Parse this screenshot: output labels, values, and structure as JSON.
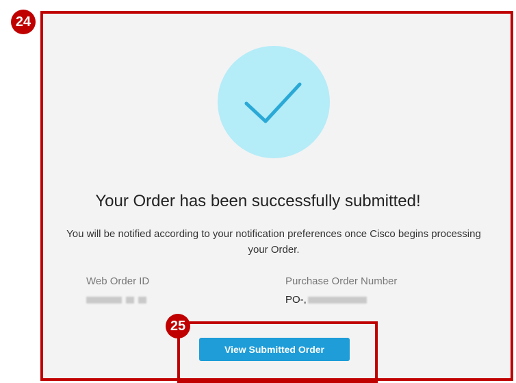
{
  "callouts": {
    "panel_number": "24",
    "button_number": "25"
  },
  "icons": {
    "success": "checkmark-icon"
  },
  "colors": {
    "callout_red": "#c00000",
    "success_circle": "#b4ecf8",
    "checkmark": "#2aa9d6",
    "primary_button": "#1e9dd8",
    "panel_background": "#f3f3f3"
  },
  "confirmation": {
    "title": "Your Order has been successfully submitted!",
    "message": "You will be notified according to your notification preferences once Cisco begins processing your Order.",
    "web_order_id_label": "Web Order ID",
    "purchase_order_label": "Purchase Order Number",
    "purchase_order_prefix": "PO-,"
  },
  "actions": {
    "view_submitted_order": "View Submitted Order"
  }
}
